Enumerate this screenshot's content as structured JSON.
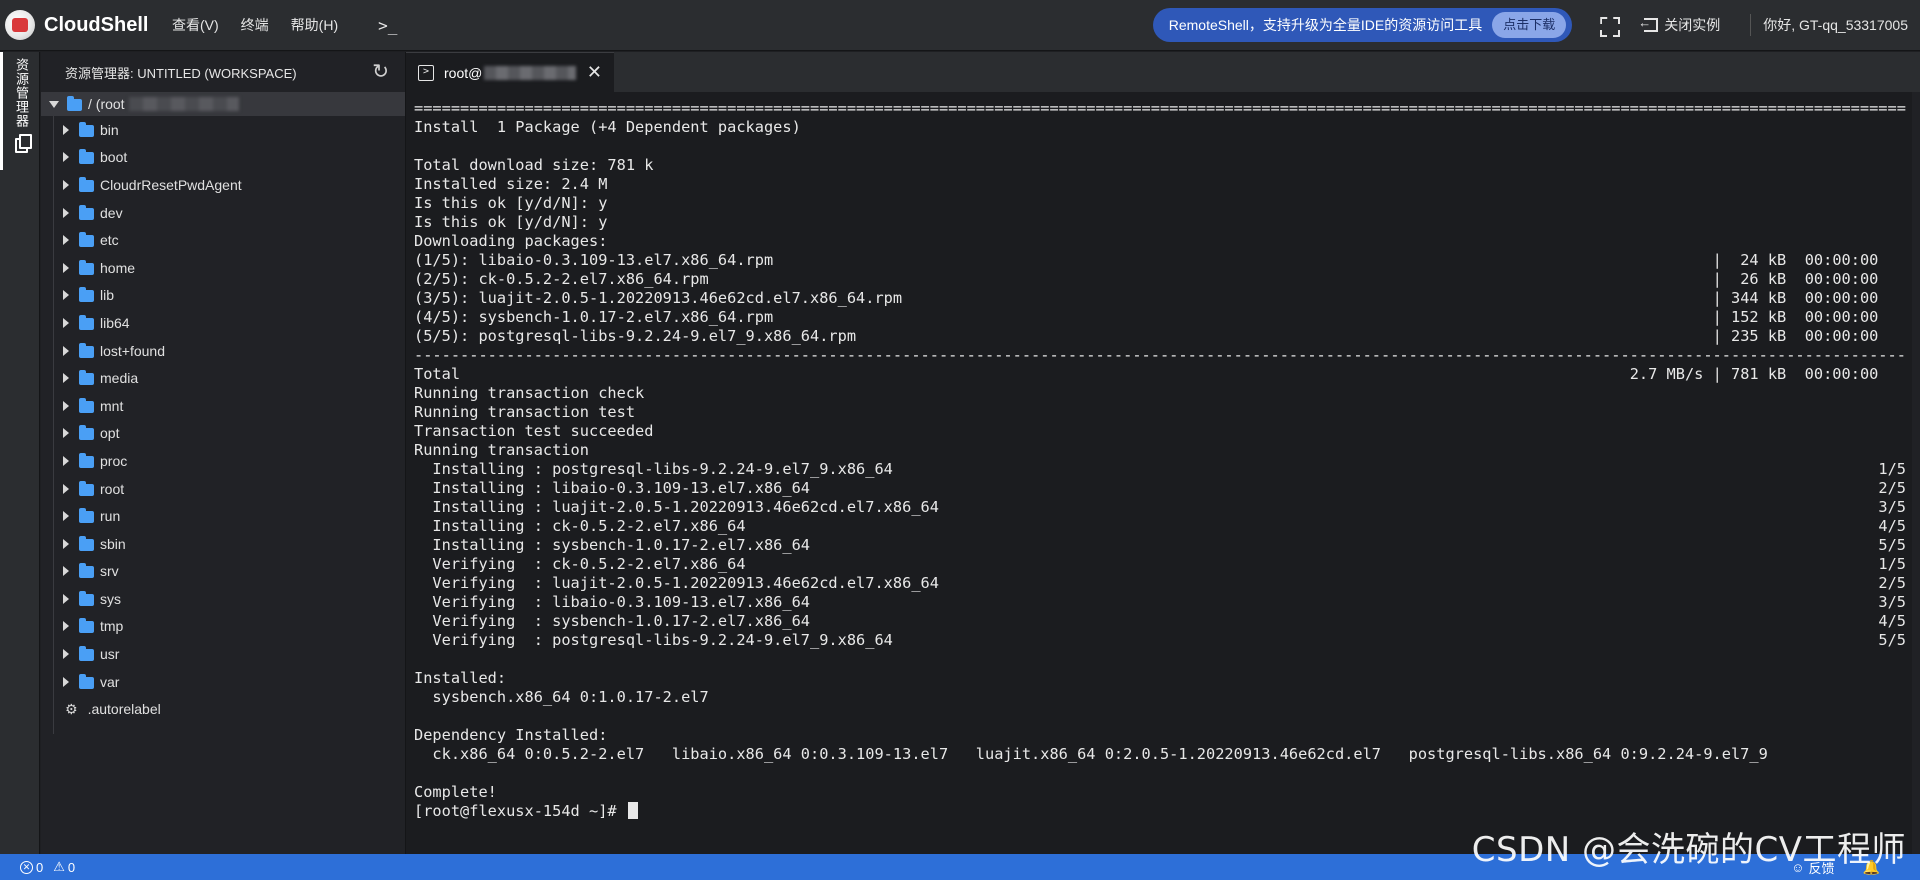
{
  "app": {
    "name": "CloudShell",
    "menu": [
      "查看(V)",
      "终端",
      "帮助(H)"
    ],
    "promo_text": "RemoteShell，支持升级为全量IDE的资源访问工具",
    "promo_button": "点击下载",
    "close_instance": "关闭实例",
    "greeting": "你好, GT-qq_53317005"
  },
  "activity": {
    "explorer_tab": "资源管理器"
  },
  "explorer": {
    "title": "资源管理器: UNTITLED (WORKSPACE)",
    "root_label": "/ (root",
    "folders": [
      "bin",
      "boot",
      "CloudrResetPwdAgent",
      "dev",
      "etc",
      "home",
      "lib",
      "lib64",
      "lost+found",
      "media",
      "mnt",
      "opt",
      "proc",
      "root",
      "run",
      "sbin",
      "srv",
      "sys",
      "tmp",
      "usr",
      "var"
    ],
    "files": [
      ".autorelabel"
    ]
  },
  "tab": {
    "label": "root@"
  },
  "terminal": {
    "separator_double": "====================================================================================================================================================================================================================================",
    "separator_single": "------------------------------------------------------------------------------------------------------------------------------------------------------------------------------------------------------------------------------------",
    "lines": [
      {
        "l": "Install  1 Package (+4 Dependent packages)",
        "r": ""
      },
      {
        "l": "",
        "r": ""
      },
      {
        "l": "Total download size: 781 k",
        "r": ""
      },
      {
        "l": "Installed size: 2.4 M",
        "r": ""
      },
      {
        "l": "Is this ok [y/d/N]: y",
        "r": ""
      },
      {
        "l": "Is this ok [y/d/N]: y",
        "r": ""
      },
      {
        "l": "Downloading packages:",
        "r": ""
      },
      {
        "l": "(1/5): libaio-0.3.109-13.el7.x86_64.rpm",
        "r": "|  24 kB  00:00:00   "
      },
      {
        "l": "(2/5): ck-0.5.2-2.el7.x86_64.rpm",
        "r": "|  26 kB  00:00:00   "
      },
      {
        "l": "(3/5): luajit-2.0.5-1.20220913.46e62cd.el7.x86_64.rpm",
        "r": "| 344 kB  00:00:00   "
      },
      {
        "l": "(4/5): sysbench-1.0.17-2.el7.x86_64.rpm",
        "r": "| 152 kB  00:00:00   "
      },
      {
        "l": "(5/5): postgresql-libs-9.2.24-9.el7_9.x86_64.rpm",
        "r": "| 235 kB  00:00:00   "
      },
      {
        "l": "SEP_SINGLE",
        "r": ""
      },
      {
        "l": "Total",
        "r": "2.7 MB/s | 781 kB  00:00:00   "
      },
      {
        "l": "Running transaction check",
        "r": ""
      },
      {
        "l": "Running transaction test",
        "r": ""
      },
      {
        "l": "Transaction test succeeded",
        "r": ""
      },
      {
        "l": "Running transaction",
        "r": ""
      },
      {
        "l": "  Installing : postgresql-libs-9.2.24-9.el7_9.x86_64",
        "r": "1/5"
      },
      {
        "l": "  Installing : libaio-0.3.109-13.el7.x86_64",
        "r": "2/5"
      },
      {
        "l": "  Installing : luajit-2.0.5-1.20220913.46e62cd.el7.x86_64",
        "r": "3/5"
      },
      {
        "l": "  Installing : ck-0.5.2-2.el7.x86_64",
        "r": "4/5"
      },
      {
        "l": "  Installing : sysbench-1.0.17-2.el7.x86_64",
        "r": "5/5"
      },
      {
        "l": "  Verifying  : ck-0.5.2-2.el7.x86_64",
        "r": "1/5"
      },
      {
        "l": "  Verifying  : luajit-2.0.5-1.20220913.46e62cd.el7.x86_64",
        "r": "2/5"
      },
      {
        "l": "  Verifying  : libaio-0.3.109-13.el7.x86_64",
        "r": "3/5"
      },
      {
        "l": "  Verifying  : sysbench-1.0.17-2.el7.x86_64",
        "r": "4/5"
      },
      {
        "l": "  Verifying  : postgresql-libs-9.2.24-9.el7_9.x86_64",
        "r": "5/5"
      },
      {
        "l": "",
        "r": ""
      },
      {
        "l": "Installed:",
        "r": ""
      },
      {
        "l": "  sysbench.x86_64 0:1.0.17-2.el7",
        "r": ""
      },
      {
        "l": "",
        "r": ""
      },
      {
        "l": "Dependency Installed:",
        "r": ""
      },
      {
        "l": "  ck.x86_64 0:0.5.2-2.el7   libaio.x86_64 0:0.3.109-13.el7   luajit.x86_64 0:2.0.5-1.20220913.46e62cd.el7   postgresql-libs.x86_64 0:9.2.24-9.el7_9",
        "r": ""
      },
      {
        "l": "",
        "r": ""
      },
      {
        "l": "Complete!",
        "r": ""
      }
    ],
    "prompt": "[root@flexusx-154d ~]# "
  },
  "status": {
    "errors": "0",
    "warnings": "0",
    "feedback": "反馈"
  },
  "watermark": "CSDN @会洗碗的CV工程师",
  "colors": {
    "header_bg": "#2b2d30",
    "promo_bg": "#2f58b8",
    "folder": "#4a9ff5",
    "statusbar": "#2d6fd8",
    "terminal_bg": "#1b1c1f"
  }
}
